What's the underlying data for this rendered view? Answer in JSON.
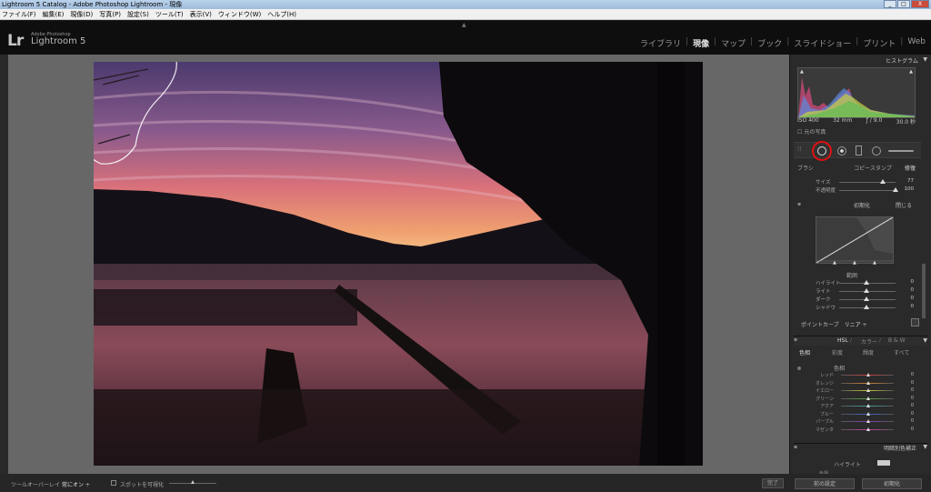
{
  "window": {
    "title": "Lightroom 5 Catalog - Adobe Photoshop Lightroom - 現像",
    "buttons": [
      "_",
      "□",
      "X"
    ]
  },
  "menu": [
    "ファイル(F)",
    "編集(E)",
    "現像(D)",
    "写真(P)",
    "設定(S)",
    "ツール(T)",
    "表示(V)",
    "ウィンドウ(W)",
    "ヘルプ(H)"
  ],
  "logo": {
    "mark": "Lr",
    "adobe": "Adobe Photoshop",
    "name": "Lightroom 5"
  },
  "modules": [
    {
      "label": "ライブラリ",
      "active": false
    },
    {
      "label": "現像",
      "active": true
    },
    {
      "label": "マップ",
      "active": false
    },
    {
      "label": "ブック",
      "active": false
    },
    {
      "label": "スライドショー",
      "active": false
    },
    {
      "label": "プリント",
      "active": false
    },
    {
      "label": "Web",
      "active": false
    }
  ],
  "histogram": {
    "title": "ヒストグラム",
    "iso": "ISO 400",
    "focal": "32 mm",
    "aperture": "ƒ / 9.0",
    "shutter": "30.0 秒",
    "original_label": "元の写真"
  },
  "spot_tool": {
    "mode_brush": "ブラシ",
    "mode_clone": "コピースタンプ",
    "mode_heal": "修復",
    "size_label": "サイズ",
    "size_value": "77",
    "size_level": 0.77,
    "opacity_label": "不透明度",
    "opacity_value": "100",
    "opacity_level": 1.0,
    "reset": "初期化",
    "close": "閉じる"
  },
  "tone_curve": {
    "region_label": "範囲",
    "sliders": [
      {
        "label": "ハイライト",
        "value": "0"
      },
      {
        "label": "ライト",
        "value": "0"
      },
      {
        "label": "ダーク",
        "value": "0"
      },
      {
        "label": "シャドウ",
        "value": "0"
      }
    ],
    "point_curve_label": "ポイントカーブ",
    "point_curve_value": "リニア ÷"
  },
  "hsl": {
    "title_hsl": "HSL",
    "title_color": "カラー",
    "title_bw": "B & W",
    "tabs": [
      "色相",
      "彩度",
      "輝度",
      "すべて"
    ],
    "group_label": "色相",
    "rows": [
      {
        "label": "レッド",
        "value": "0",
        "color": "#c84040"
      },
      {
        "label": "オレンジ",
        "value": "0",
        "color": "#d08030"
      },
      {
        "label": "イエロー",
        "value": "0",
        "color": "#c8c040"
      },
      {
        "label": "グリーン",
        "value": "0",
        "color": "#50a040"
      },
      {
        "label": "アクア",
        "value": "0",
        "color": "#40a0a0"
      },
      {
        "label": "ブルー",
        "value": "0",
        "color": "#4060c0"
      },
      {
        "label": "パープル",
        "value": "0",
        "color": "#8040b0"
      },
      {
        "label": "マゼンタ",
        "value": "0",
        "color": "#c040a0"
      }
    ]
  },
  "split_toning": {
    "title": "明暗別色補正",
    "highlight_label": "ハイライト",
    "hue_label": "色相"
  },
  "toolbar": {
    "overlay_label": "ツールオーバーレイ :",
    "overlay_value": "常にオン ÷",
    "visualize_label": "スポットを可視化",
    "done": "完了"
  },
  "bottom_right": {
    "previous": "前の設定",
    "reset": "初期化"
  }
}
